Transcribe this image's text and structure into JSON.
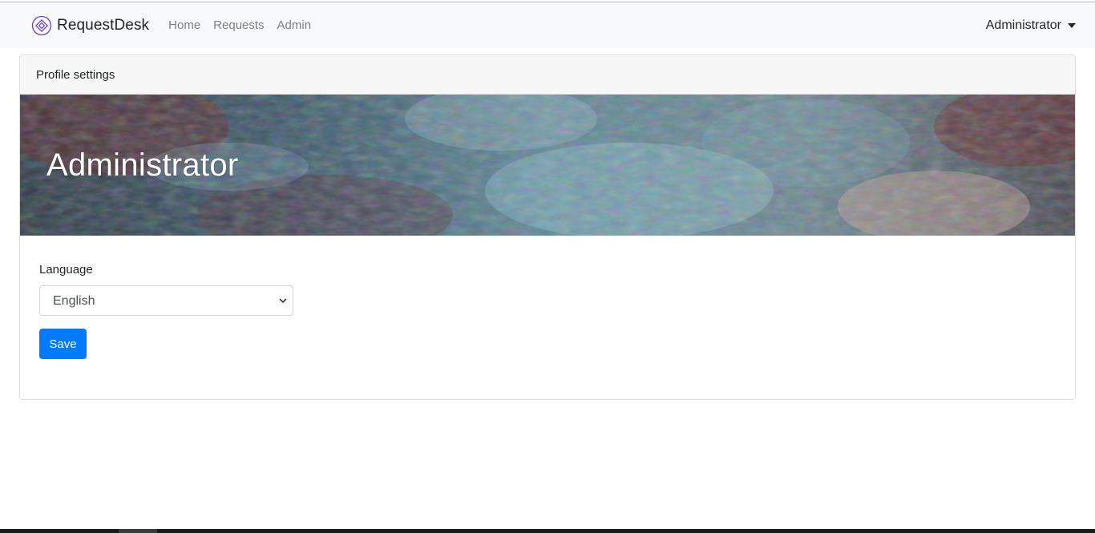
{
  "navbar": {
    "brand": "RequestDesk",
    "brand_icon": "diamond-logo-icon",
    "links": [
      {
        "label": "Home"
      },
      {
        "label": "Requests"
      },
      {
        "label": "Admin"
      }
    ],
    "user_menu": {
      "label": "Administrator",
      "icon": "caret-down-icon"
    }
  },
  "card": {
    "header": "Profile settings",
    "banner_title": "Administrator"
  },
  "form": {
    "language_label": "Language",
    "language_value": "English",
    "save_label": "Save"
  },
  "colors": {
    "primary": "#007bff",
    "navbar_bg": "#f8f9fa",
    "brand_accent": "#6f42c1"
  }
}
